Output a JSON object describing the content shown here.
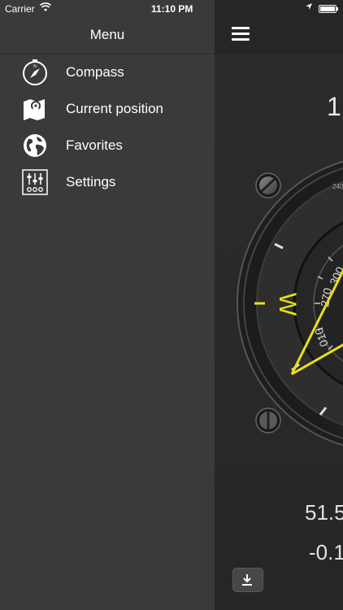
{
  "status_bar": {
    "carrier": "Carrier",
    "time": "11:10 PM",
    "wifi_icon": "wifi-icon",
    "location_icon": "location-arrow-icon",
    "battery_icon": "battery-icon"
  },
  "menu": {
    "title": "Menu",
    "items": [
      {
        "label": "Compass",
        "icon": "compass-icon"
      },
      {
        "label": "Current position",
        "icon": "map-pin-icon"
      },
      {
        "label": "Favorites",
        "icon": "globe-icon"
      },
      {
        "label": "Settings",
        "icon": "sliders-icon"
      }
    ]
  },
  "content": {
    "menu_button_icon": "hamburger-icon",
    "heading_value": "1",
    "latitude": "51.5",
    "longitude": "-0.1",
    "compass_west_label": "W",
    "compass_ticks": [
      "270",
      "300",
      "240",
      "010"
    ],
    "download_icon": "download-icon"
  },
  "colors": {
    "menu_bg": "#3a3a3a",
    "content_bg": "#2b2b2b",
    "accent": "#e8e01a"
  }
}
